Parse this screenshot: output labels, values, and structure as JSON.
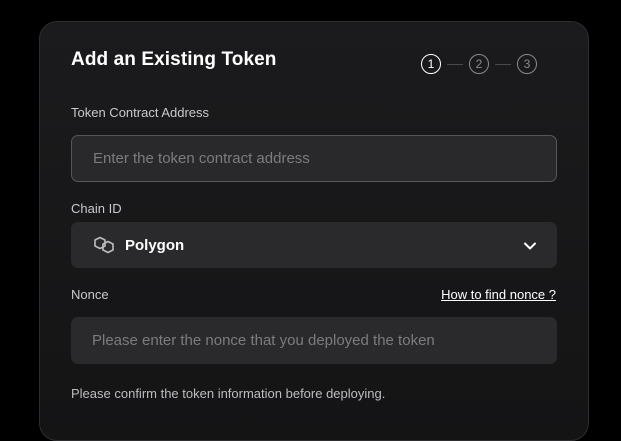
{
  "form": {
    "title": "Add an Existing Token",
    "steps": [
      "1",
      "2",
      "3"
    ],
    "active_step": "1",
    "token_address": {
      "label": "Token Contract Address",
      "value": "",
      "placeholder": "Enter the token contract address"
    },
    "chain": {
      "label": "Chain ID",
      "selected": "Polygon",
      "icon": "polygon-icon"
    },
    "nonce": {
      "label": "Nonce",
      "help_link": "How to find nonce ?",
      "value": "",
      "placeholder": "Please enter the nonce that you deployed the token"
    },
    "note": "Please confirm the token information before deploying."
  },
  "colors": {
    "background": "#000000",
    "card": "#1b1b1d",
    "field": "#2a2a2c",
    "text": "#ffffff",
    "muted": "#7c7c80"
  }
}
